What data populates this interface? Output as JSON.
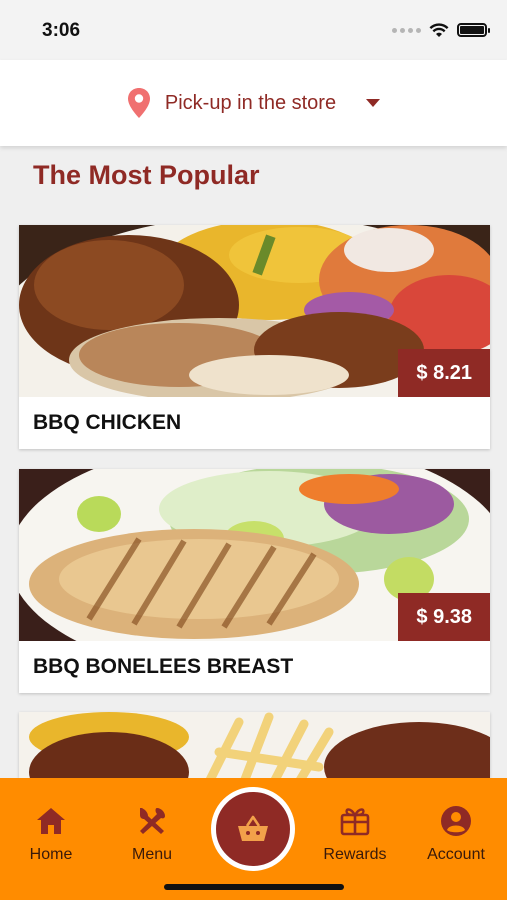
{
  "status_bar": {
    "time": "3:06"
  },
  "location": {
    "label": "Pick-up in the store",
    "icon": "map-pin-icon",
    "accent": "#f07070"
  },
  "section": {
    "title": "The Most Popular"
  },
  "products": [
    {
      "name": "BBQ CHICKEN",
      "price": "$ 8.21"
    },
    {
      "name": "BBQ BONELEES BREAST",
      "price": "$ 9.38"
    },
    {
      "name": "",
      "price": ""
    }
  ],
  "nav": {
    "home": "Home",
    "menu": "Menu",
    "rewards": "Rewards",
    "account": "Account"
  },
  "colors": {
    "brand": "#8f2a25",
    "nav_background": "#ff8c00",
    "background": "#efefef"
  }
}
